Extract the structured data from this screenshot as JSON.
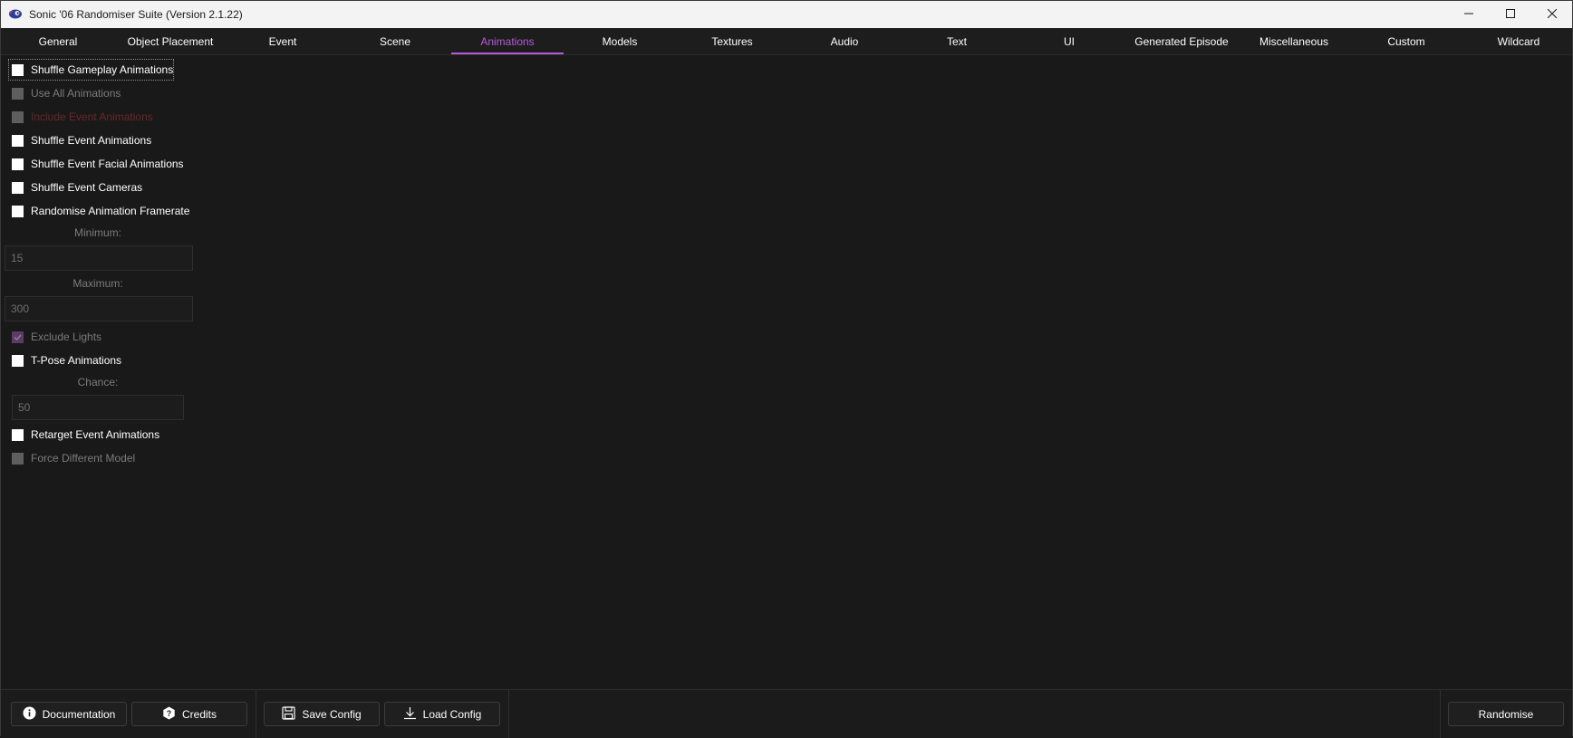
{
  "window": {
    "title": "Sonic '06 Randomiser Suite (Version 2.1.22)"
  },
  "tabs": [
    {
      "label": "General"
    },
    {
      "label": "Object Placement"
    },
    {
      "label": "Event"
    },
    {
      "label": "Scene"
    },
    {
      "label": "Animations",
      "active": true
    },
    {
      "label": "Models"
    },
    {
      "label": "Textures"
    },
    {
      "label": "Audio"
    },
    {
      "label": "Text"
    },
    {
      "label": "UI"
    },
    {
      "label": "Generated Episode"
    },
    {
      "label": "Miscellaneous"
    },
    {
      "label": "Custom"
    },
    {
      "label": "Wildcard"
    }
  ],
  "options": {
    "shuffle_gameplay": {
      "label": "Shuffle Gameplay Animations",
      "checked": false,
      "enabled": true
    },
    "use_all": {
      "label": "Use All Animations",
      "checked": false,
      "enabled": false
    },
    "include_event": {
      "label": "Include Event Animations",
      "checked": false,
      "enabled": false
    },
    "shuffle_event": {
      "label": "Shuffle Event Animations",
      "checked": false,
      "enabled": true
    },
    "shuffle_facial": {
      "label": "Shuffle Event Facial Animations",
      "checked": false,
      "enabled": true
    },
    "shuffle_cameras": {
      "label": "Shuffle Event Cameras",
      "checked": false,
      "enabled": true
    },
    "randomise_framerate": {
      "label": "Randomise Animation Framerate",
      "checked": false,
      "enabled": true
    },
    "minimum": {
      "label": "Minimum:",
      "value": "15"
    },
    "maximum": {
      "label": "Maximum:",
      "value": "300"
    },
    "exclude_lights": {
      "label": "Exclude Lights",
      "checked": true,
      "enabled": false
    },
    "tpose": {
      "label": "T-Pose Animations",
      "checked": false,
      "enabled": true
    },
    "chance": {
      "label": "Chance:",
      "value": "50"
    },
    "retarget": {
      "label": "Retarget Event Animations",
      "checked": false,
      "enabled": true
    },
    "force_different": {
      "label": "Force Different Model",
      "checked": false,
      "enabled": false
    }
  },
  "footer": {
    "documentation": "Documentation",
    "credits": "Credits",
    "save_config": "Save Config",
    "load_config": "Load Config",
    "randomise": "Randomise"
  },
  "colors": {
    "accent": "#b65ad8",
    "background": "#191919",
    "titlebar": "#f3f3f3"
  }
}
